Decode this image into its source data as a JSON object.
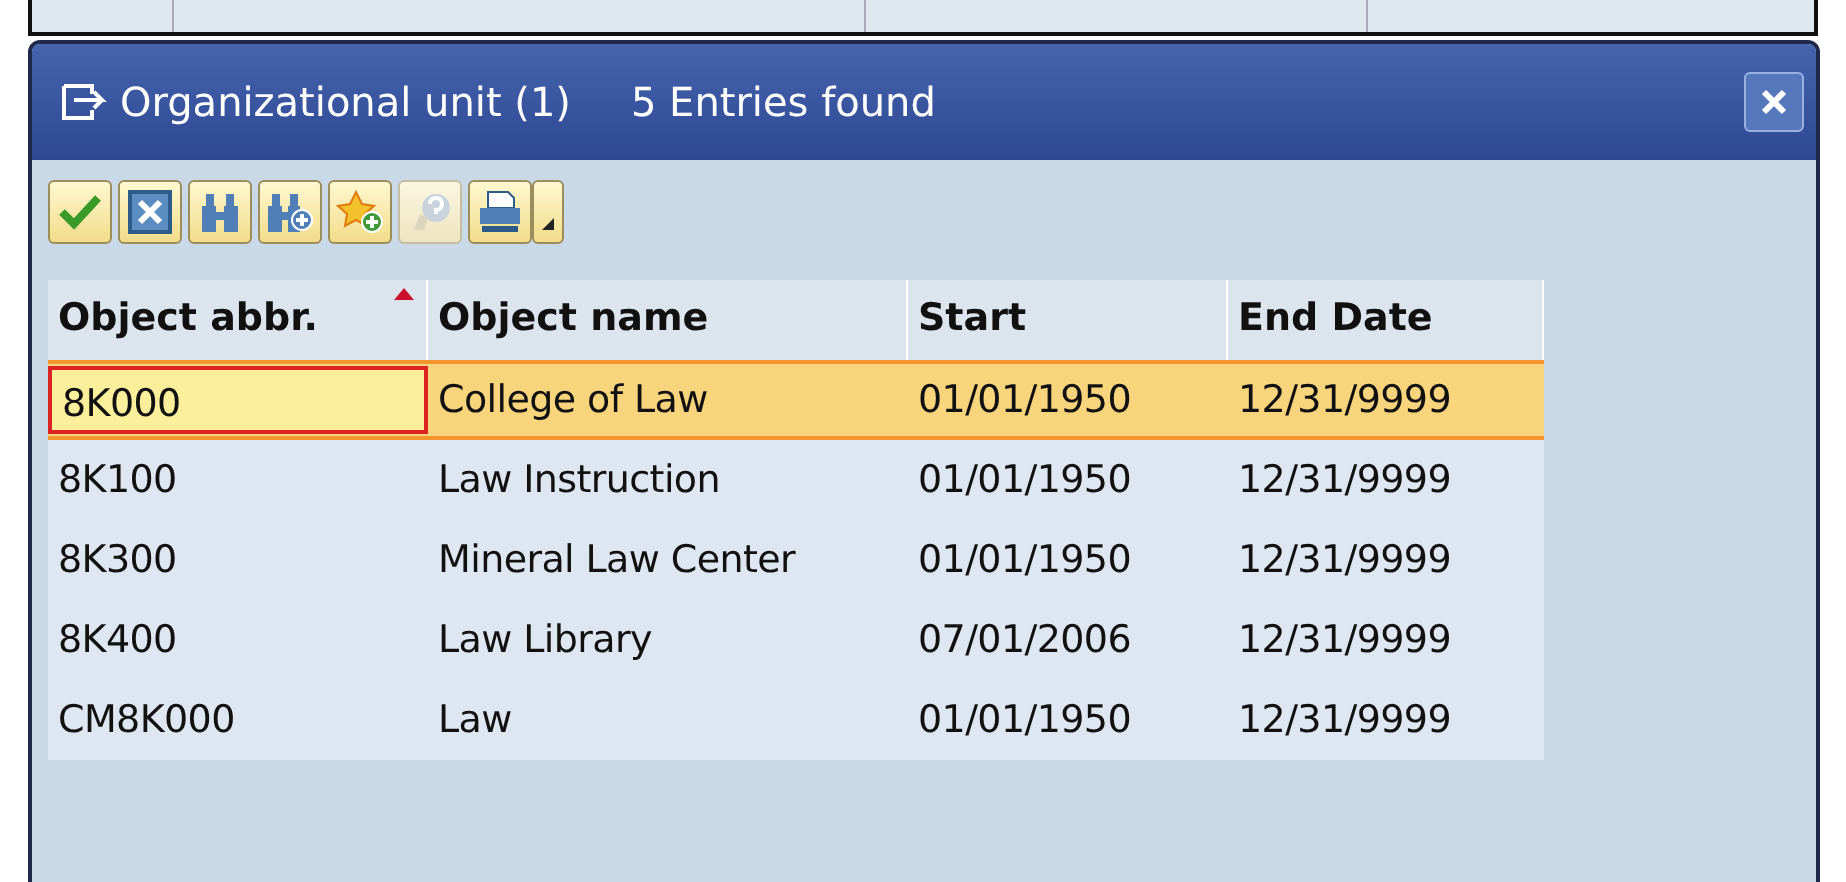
{
  "window": {
    "title": "Organizational unit (1)",
    "subtitle": "5 Entries found"
  },
  "toolbar": [
    {
      "kind": "check",
      "disabled": false
    },
    {
      "kind": "cancel",
      "disabled": false
    },
    {
      "kind": "find",
      "disabled": false
    },
    {
      "kind": "find-next",
      "disabled": false
    },
    {
      "kind": "favorite-add",
      "disabled": false
    },
    {
      "kind": "help",
      "disabled": true
    },
    {
      "kind": "print",
      "disabled": false
    },
    {
      "kind": "dropdown",
      "disabled": false
    }
  ],
  "table": {
    "columns": [
      {
        "label": "Object abbr.",
        "sorted": true
      },
      {
        "label": "Object name",
        "sorted": false
      },
      {
        "label": "Start",
        "sorted": false
      },
      {
        "label": "End Date",
        "sorted": false
      }
    ],
    "rows": [
      {
        "cells": [
          "8K000",
          "College of Law",
          "01/01/1950",
          "12/31/9999"
        ],
        "selected": true,
        "focused": true
      },
      {
        "cells": [
          "8K100",
          "Law Instruction",
          "01/01/1950",
          "12/31/9999"
        ],
        "selected": false,
        "focused": false
      },
      {
        "cells": [
          "8K300",
          "Mineral Law Center",
          "01/01/1950",
          "12/31/9999"
        ],
        "selected": false,
        "focused": false
      },
      {
        "cells": [
          "8K400",
          "Law Library",
          "07/01/2006",
          "12/31/9999"
        ],
        "selected": false,
        "focused": false
      },
      {
        "cells": [
          "CM8K000",
          "Law",
          "01/01/1950",
          "12/31/9999"
        ],
        "selected": false,
        "focused": false
      }
    ]
  }
}
